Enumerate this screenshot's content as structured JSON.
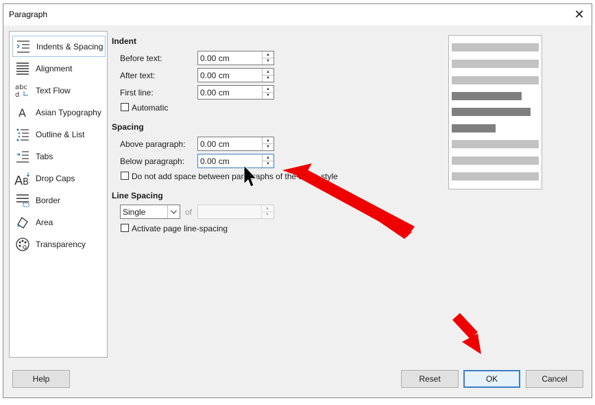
{
  "dialog": {
    "title": "Paragraph",
    "close_glyph": "✕"
  },
  "sidebar": {
    "items": [
      {
        "label": "Indents & Spacing",
        "icon": "indents-spacing-icon",
        "selected": true
      },
      {
        "label": "Alignment",
        "icon": "alignment-icon",
        "selected": false
      },
      {
        "label": "Text Flow",
        "icon": "text-flow-icon",
        "selected": false
      },
      {
        "label": "Asian Typography",
        "icon": "asian-typography-icon",
        "selected": false
      },
      {
        "label": "Outline & List",
        "icon": "outline-list-icon",
        "selected": false
      },
      {
        "label": "Tabs",
        "icon": "tabs-icon",
        "selected": false
      },
      {
        "label": "Drop Caps",
        "icon": "drop-caps-icon",
        "selected": false
      },
      {
        "label": "Border",
        "icon": "border-icon",
        "selected": false
      },
      {
        "label": "Area",
        "icon": "area-icon",
        "selected": false
      },
      {
        "label": "Transparency",
        "icon": "transparency-icon",
        "selected": false
      }
    ]
  },
  "indent": {
    "title": "Indent",
    "before_label": "Before text:",
    "before_value": "0.00 cm",
    "after_label": "After text:",
    "after_value": "0.00 cm",
    "first_label": "First line:",
    "first_value": "0.00 cm",
    "automatic_label": "Automatic",
    "automatic_checked": false
  },
  "spacing": {
    "title": "Spacing",
    "above_label": "Above paragraph:",
    "above_value": "0.00 cm",
    "below_label": "Below paragraph:",
    "below_value": "0.00 cm",
    "no_space_label": "Do not add space between paragraphs of the same style",
    "no_space_checked": false
  },
  "line_spacing": {
    "title": "Line Spacing",
    "selected": "Single",
    "of_label": "of",
    "of_value": "",
    "page_line_label": "Activate page line-spacing",
    "page_line_checked": false
  },
  "buttons": {
    "help": "Help",
    "reset": "Reset",
    "ok": "OK",
    "cancel": "Cancel"
  },
  "colors": {
    "accent": "#3c7fc1",
    "annotation_arrow": "#ee0000",
    "preview_light": "#c2c2c2",
    "preview_dark": "#7f7f7f"
  }
}
